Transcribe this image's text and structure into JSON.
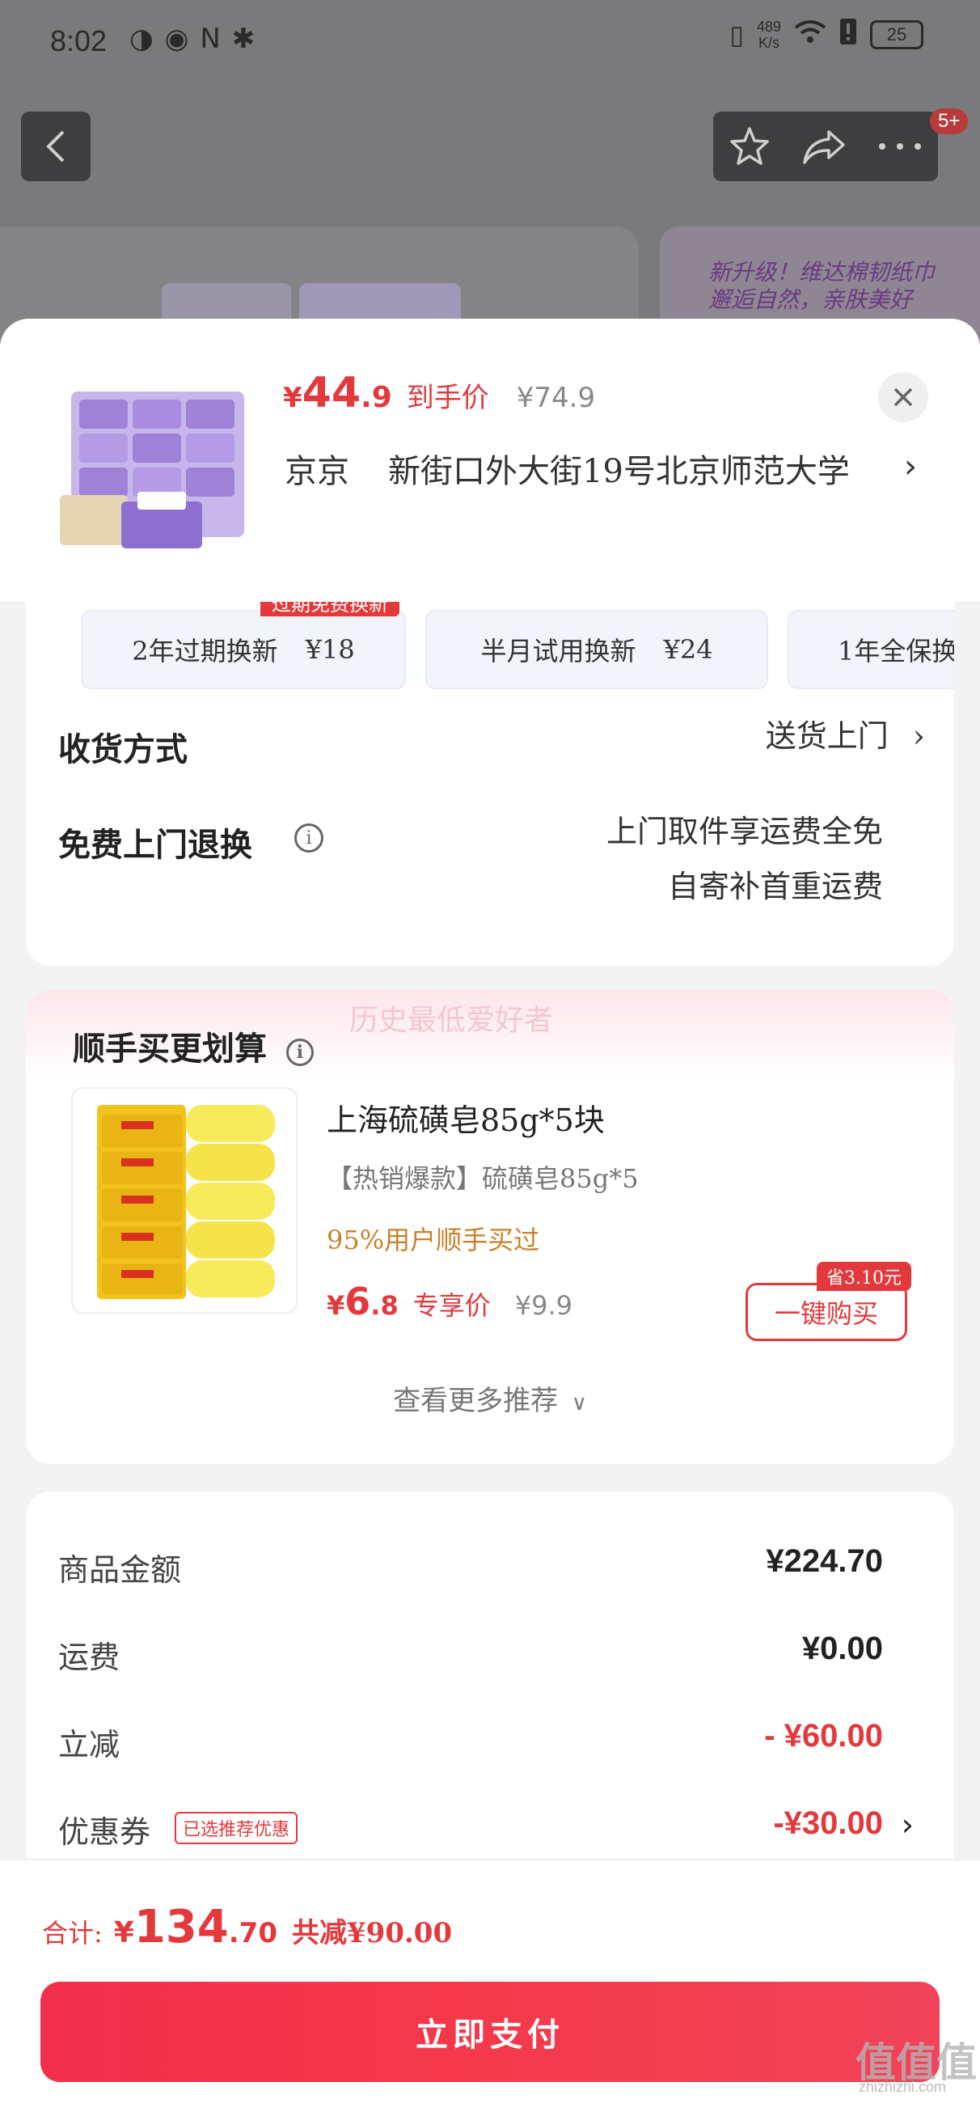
{
  "status_bar": {
    "time": "8:02",
    "net_speed_value": "489",
    "net_speed_unit": "K/s",
    "battery": "25"
  },
  "top_nav": {
    "badge": "5+"
  },
  "background_banner": {
    "line1": "新升级！维达棉韧纸巾",
    "line2": "邂逅自然，亲肤美好"
  },
  "product": {
    "price_currency": "¥",
    "price_int": "44",
    "price_dec": ".9",
    "price_label": "到手价",
    "original_price": "¥74.9",
    "address_city": "京京",
    "address_detail": "新街口外大街19号北京师范大学"
  },
  "services": {
    "flag": "过期免费换新",
    "items": [
      {
        "label": "2年过期换新",
        "price": "¥18"
      },
      {
        "label": "半月试用换新",
        "price": "¥24"
      },
      {
        "label": "1年全保换",
        "price": ""
      }
    ]
  },
  "delivery": {
    "label": "收货方式",
    "value": "送货上门"
  },
  "returns": {
    "label": "免费上门退换",
    "value_line1": "上门取件享运费全免",
    "value_line2": "自寄补首重运费"
  },
  "recommend": {
    "watermark": "历史最低爱好者",
    "title": "顺手买更划算",
    "item_name": "上海硫磺皂85g*5块",
    "item_sub": "【热销爆款】硫磺皂85g*5",
    "item_social": "95%用户顺手买过",
    "price_currency": "¥",
    "price_int": "6",
    "price_dec": ".8",
    "price_label": "专享价",
    "original_price": "¥9.9",
    "save_badge": "省3.10元",
    "buy_label": "一键购买",
    "more_label": "查看更多推荐"
  },
  "summary": {
    "rows": [
      {
        "label": "商品金额",
        "value": "¥224.70"
      },
      {
        "label": "运费",
        "value": "¥0.00"
      },
      {
        "label": "立减",
        "value": "- ¥60.00"
      },
      {
        "label": "优惠券",
        "value": "-¥30.00",
        "tag": "已选推荐优惠"
      }
    ]
  },
  "footer": {
    "total_label": "合计:",
    "total_currency": "¥",
    "total_int": "134",
    "total_dec": ".70",
    "total_reduce": "共减¥90.00",
    "pay_label": "立即支付"
  },
  "watermark": {
    "site": "值值值",
    "domain": "zhizhizhi.com"
  },
  "colors": {
    "accent": "#e4393c",
    "social": "#c8812a",
    "pay_button": "#f2304e"
  }
}
